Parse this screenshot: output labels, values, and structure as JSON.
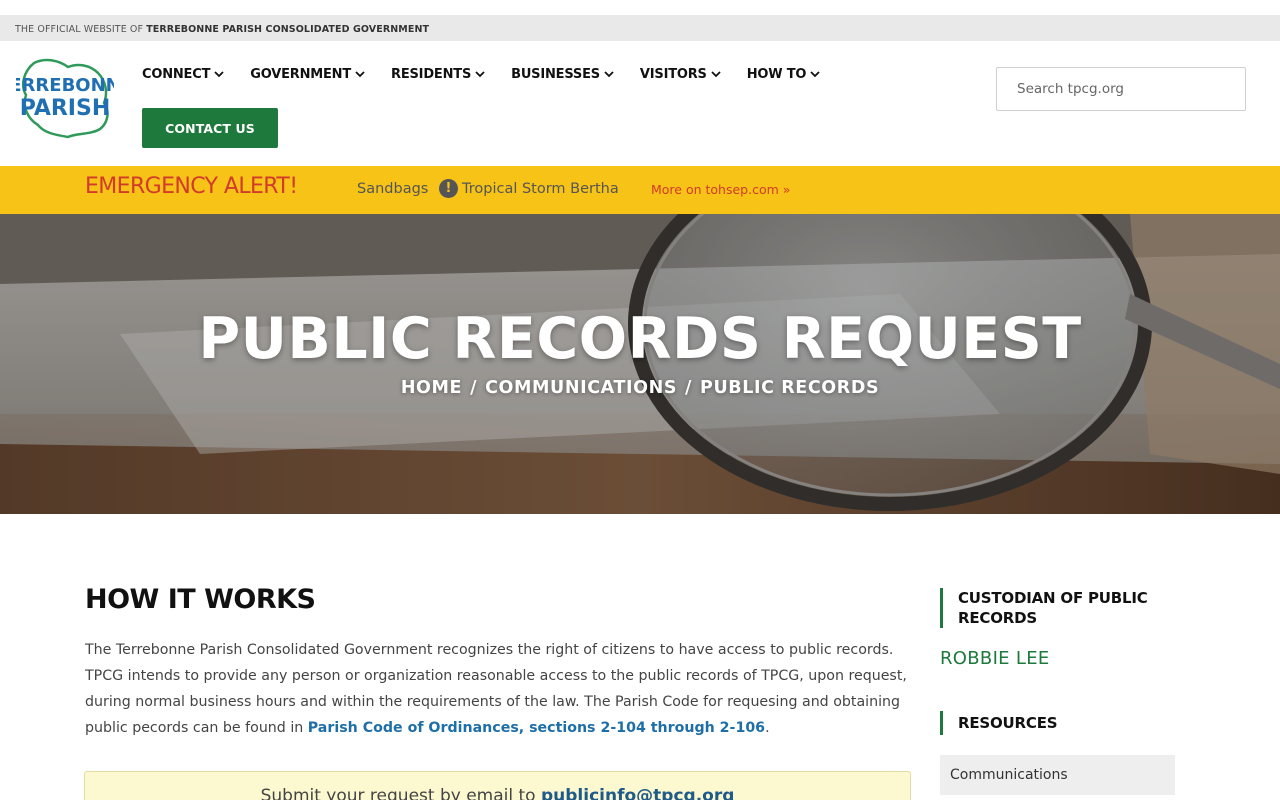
{
  "topbar": {
    "prefix": "THE OFFICIAL WEBSITE OF",
    "org": "TERREBONNE PARISH CONSOLIDATED GOVERNMENT"
  },
  "logo": {
    "line1": "TERREBONNE",
    "line2": "PARISH"
  },
  "nav": {
    "items": [
      {
        "label": "CONNECT"
      },
      {
        "label": "GOVERNMENT"
      },
      {
        "label": "RESIDENTS"
      },
      {
        "label": "BUSINESSES"
      },
      {
        "label": "VISITORS"
      },
      {
        "label": "HOW TO"
      }
    ],
    "contact_label": "CONTACT US"
  },
  "search": {
    "placeholder": "Search tpcg.org"
  },
  "alert": {
    "title": "EMERGENCY ALERT!",
    "item1": "Sandbags",
    "item2": "Tropical Storm Bertha",
    "more": "More on tohsep.com »"
  },
  "hero": {
    "title": "PUBLIC RECORDS REQUEST",
    "breadcrumb": [
      "HOME",
      "COMMUNICATIONS",
      "PUBLIC RECORDS"
    ],
    "separator": "/"
  },
  "main": {
    "heading": "HOW IT WORKS",
    "paragraph": "The Terrebonne Parish Consolidated Government recognizes the right of citizens to have access to public records. TPCG intends to provide any person or organization reasonable access to the public records of TPCG, upon request, during normal business hours and within the requirements of the law. The Parish Code for requesing and obtaining public pecords can be found in ",
    "link": "Parish Code of Ordinances, sections 2-104 through 2-106",
    "period": ".",
    "email_prefix": "Submit your request by email to ",
    "email": "publicinfo@tpcg.org"
  },
  "sidebar": {
    "custodian_heading": "CUSTODIAN OF PUBLIC RECORDS",
    "custodian_name": "ROBBIE LEE",
    "resources_heading": "RESOURCES",
    "resources": [
      "Communications"
    ]
  },
  "colors": {
    "brand_green": "#1e7a3c",
    "alert_yellow": "#f7c316",
    "alert_red": "#d23b2c",
    "link_blue": "#1e6ea8"
  }
}
